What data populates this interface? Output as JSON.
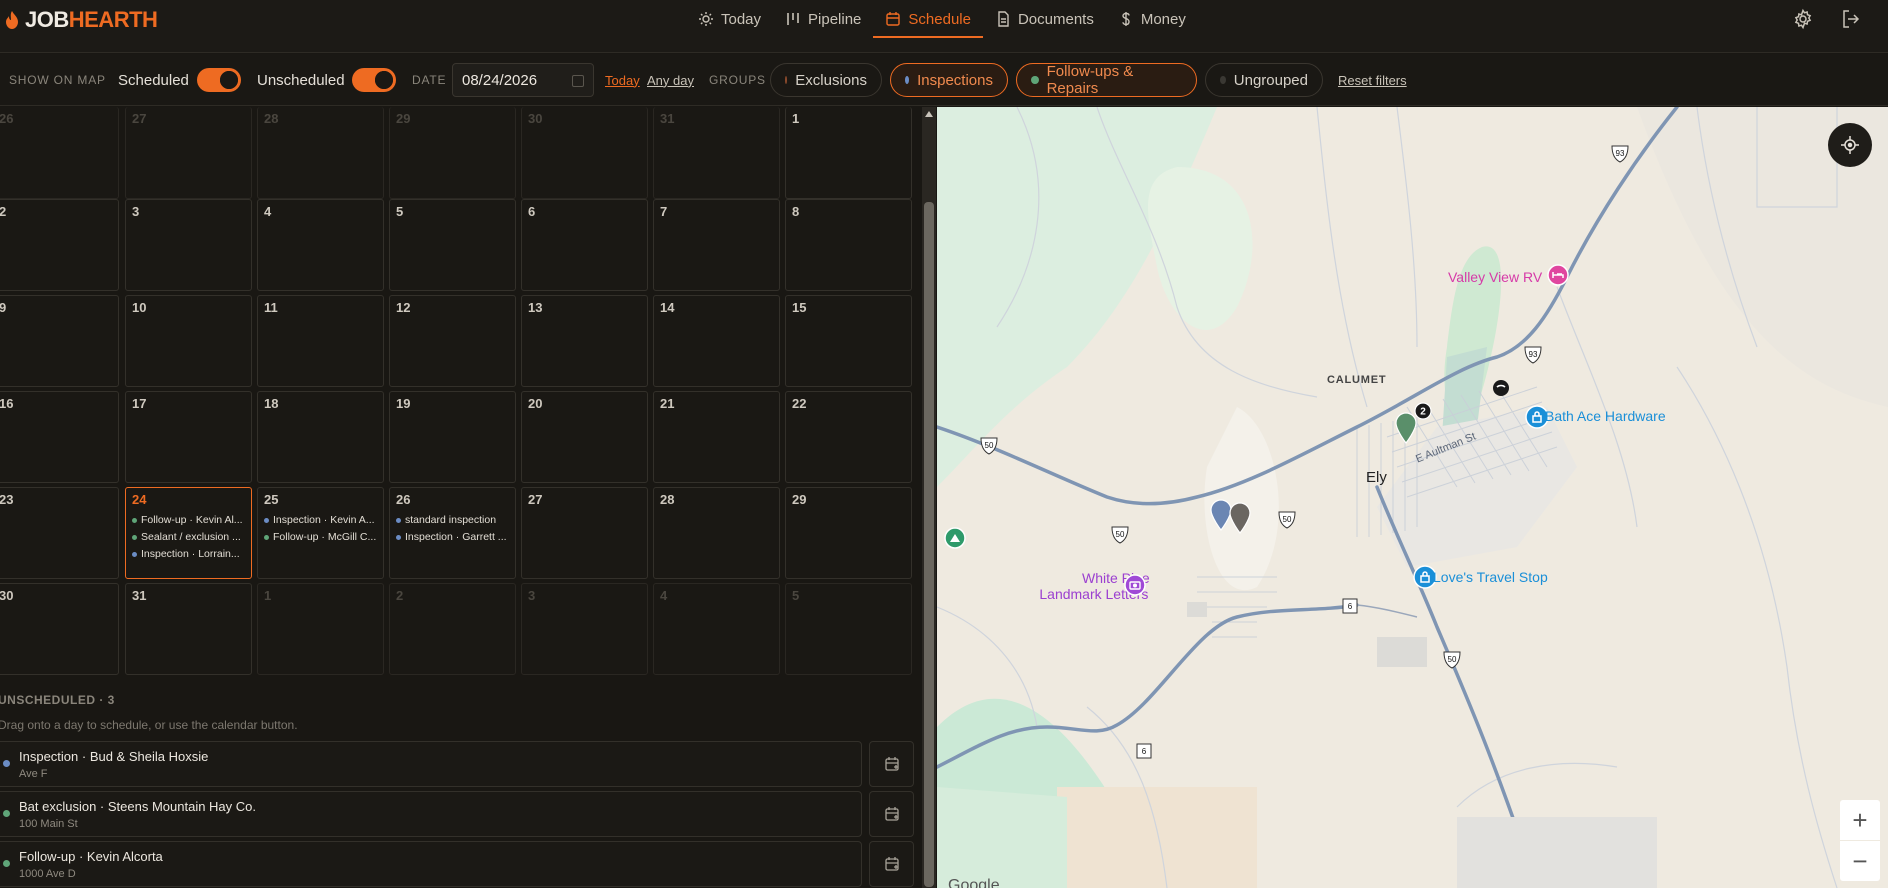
{
  "app": {
    "name_part1": "JOB",
    "name_part2": "HEARTH"
  },
  "nav": {
    "today": "Today",
    "pipeline": "Pipeline",
    "schedule": "Schedule",
    "documents": "Documents",
    "money": "Money"
  },
  "filters": {
    "show_on_map": "SHOW ON MAP",
    "scheduled": "Scheduled",
    "unscheduled": "Unscheduled",
    "date_label": "DATE",
    "date_value": "08/24/2026",
    "today_link": "Today",
    "any_day_link": "Any day",
    "groups_label": "GROUPS",
    "groups": [
      {
        "label": "Exclusions",
        "color": "#8a4a2c",
        "active": false
      },
      {
        "label": "Inspections",
        "color": "#6b8cc4",
        "active": true
      },
      {
        "label": "Follow-ups & Repairs",
        "color": "#5fa578",
        "active": true
      },
      {
        "label": "Ungrouped",
        "color": "#3a3833",
        "active": false
      }
    ],
    "reset": "Reset filters"
  },
  "calendar": {
    "weeks": [
      [
        "26",
        "27",
        "28",
        "29",
        "30",
        "31",
        "1"
      ],
      [
        "2",
        "3",
        "4",
        "5",
        "6",
        "7",
        "8"
      ],
      [
        "9",
        "10",
        "11",
        "12",
        "13",
        "14",
        "15"
      ],
      [
        "16",
        "17",
        "18",
        "19",
        "20",
        "21",
        "22"
      ],
      [
        "23",
        "24",
        "25",
        "26",
        "27",
        "28",
        "29"
      ],
      [
        "30",
        "31",
        "1",
        "2",
        "3",
        "4",
        "5"
      ]
    ],
    "events": {
      "d24": [
        {
          "text": "Follow-up · Kevin Al...",
          "color": "#5fa578"
        },
        {
          "text": "Sealant / exclusion ...",
          "color": "#5fa578"
        },
        {
          "text": "Inspection · Lorrain...",
          "color": "#6b8cc4"
        }
      ],
      "d25": [
        {
          "text": "Inspection · Kevin A...",
          "color": "#6b8cc4"
        },
        {
          "text": "Follow-up · McGill C...",
          "color": "#5fa578"
        }
      ],
      "d26": [
        {
          "text": "standard inspection",
          "color": "#6b8cc4"
        },
        {
          "text": "Inspection · Garrett ...",
          "color": "#6b8cc4"
        }
      ]
    }
  },
  "unscheduled": {
    "title": "UNSCHEDULED · 3",
    "hint": "Drag onto a day to schedule, or use the calendar button.",
    "items": [
      {
        "title": "Inspection · Bud & Sheila Hoxsie",
        "sub": "Ave F",
        "color": "#6b8cc4"
      },
      {
        "title": "Bat exclusion · Steens Mountain Hay Co.",
        "sub": "100 Main St",
        "color": "#5fa578"
      },
      {
        "title": "Follow-up · Kevin Alcorta",
        "sub": "1000 Ave D",
        "color": "#5fa578"
      }
    ]
  },
  "map": {
    "labels": {
      "valley_view": "Valley View RV",
      "calumet": "CALUMET",
      "bath_ace": "Bath Ace Hardware",
      "aultman": "E Aultman St",
      "ely": "Ely",
      "loves": "Love's Travel Stop",
      "white_pine_1": "White Pine",
      "white_pine_2": "Landmark Letters",
      "google": "Google"
    },
    "route_shields": [
      "93",
      "93",
      "50",
      "50",
      "50",
      "6",
      "50",
      "6"
    ],
    "cluster_count": "2",
    "zoom_in": "+",
    "zoom_out": "−"
  }
}
